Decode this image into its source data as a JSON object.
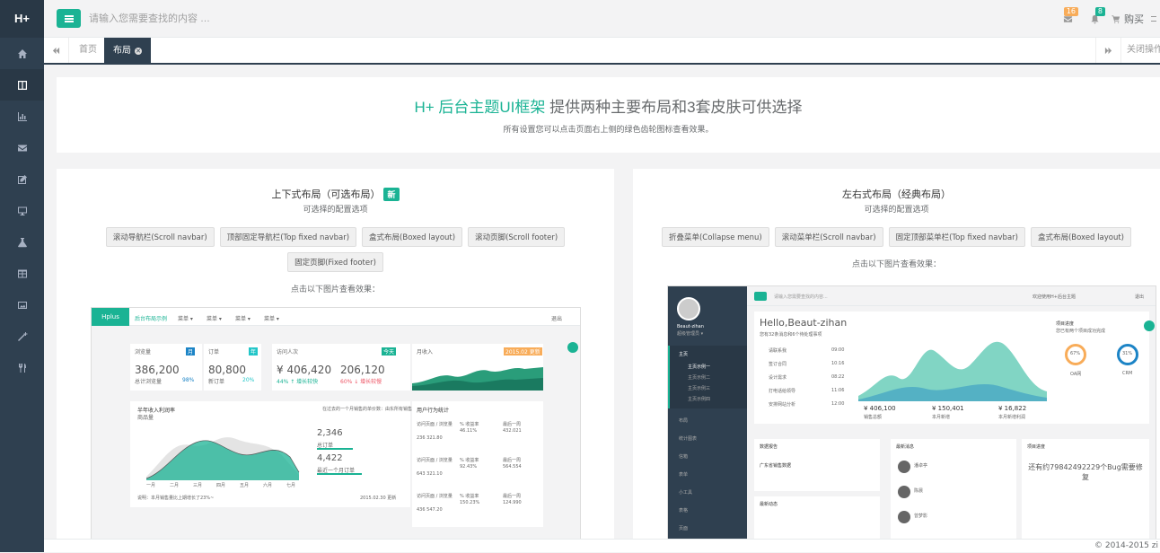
{
  "app": {
    "logo": "H+"
  },
  "sidebar": {
    "items": [
      {
        "icon": "home-icon"
      },
      {
        "icon": "columns-icon"
      },
      {
        "icon": "bar-chart-icon"
      },
      {
        "icon": "envelope-icon"
      },
      {
        "icon": "edit-icon"
      },
      {
        "icon": "desktop-icon"
      },
      {
        "icon": "flask-icon"
      },
      {
        "icon": "table-icon"
      },
      {
        "icon": "picture-icon"
      },
      {
        "icon": "magic-icon"
      },
      {
        "icon": "cutlery-icon"
      }
    ]
  },
  "header": {
    "search_placeholder": "请输入您需要查找的内容 …",
    "mail_count": "16",
    "bell_count": "8",
    "buy_label": "购买"
  },
  "tabs": {
    "home": "首页",
    "active": "布局",
    "close_ops": "关闭操作"
  },
  "hero": {
    "title_accent": "H+ 后台主题UI框架",
    "title_rest": " 提供两种主要布局和3套皮肤可供选择",
    "subtitle": "所有设置您可以点击页面右上侧的绿色齿轮图标查看效果。"
  },
  "left_card": {
    "title": "上下式布局（可选布局）",
    "badge": "新",
    "subtitle": "可选择的配置选项",
    "buttons": [
      "滚动导航栏(Scroll navbar)",
      "顶部固定导航栏(Top fixed navbar)",
      "盒式布局(Boxed layout)",
      "滚动页脚(Scroll footer)",
      "固定页脚(Fixed footer)"
    ],
    "hint": "点击以下图片查看效果："
  },
  "right_card": {
    "title": "左右式布局（经典布局）",
    "subtitle": "可选择的配置选项",
    "buttons": [
      "折叠菜单(Collapse menu)",
      "滚动菜单栏(Scroll navbar)",
      "固定顶部菜单栏(Top fixed navbar)",
      "盒式布局(Boxed layout)"
    ],
    "hint": "点击以下图片查看效果："
  },
  "preview_left": {
    "brand": "Hplus",
    "nav": [
      "后台布局示例",
      "菜单 ▾",
      "菜单 ▾",
      "菜单 ▾",
      "菜单 ▾"
    ],
    "logout": "退出",
    "stats": [
      {
        "label": "浏览量",
        "tag": "月",
        "value": "386,200",
        "sub": "总计浏览量",
        "pct": "98%"
      },
      {
        "label": "订单",
        "tag": "年",
        "value": "80,800",
        "sub": "新订单",
        "pct": "20%"
      },
      {
        "label": "访问人次",
        "tag": "今天",
        "value": "¥ 406,420",
        "value2": "206,120",
        "sub": "44% ↑ 增长较快",
        "sub2": "60% ↓ 增长较慢"
      },
      {
        "label": "月收入",
        "tag": "2015.02 更新"
      }
    ],
    "chart_title": "半年收入利润率",
    "chart_unit": "商品量",
    "chart_note": "在过去的一个月销售的单价数：由东所有销售：162,862",
    "months": [
      "一月",
      "二月",
      "三月",
      "四月",
      "五月",
      "六月",
      "七月"
    ],
    "kpi1": "2,346",
    "kpi1_label": "总订单",
    "kpi2": "4,422",
    "kpi2_label": "最近一个月订单",
    "foot_note": "说明：本月销售量比上期增长了23%~",
    "foot_date": "2015.02.30 更新",
    "side_title": "用户行为统计",
    "rows": [
      {
        "a": "访问页面 / 浏览量",
        "b": "236 321.80",
        "c": "% 收益率",
        "d": "46.11%",
        "e": "最后一周",
        "f": "432.021"
      },
      {
        "a": "访问页面 / 浏览量",
        "b": "643 321.10",
        "c": "% 收益率",
        "d": "92.43%",
        "e": "最后一周",
        "f": "564.554"
      },
      {
        "a": "访问页面 / 浏览量",
        "b": "436 547.20",
        "c": "% 收益率",
        "d": "150.23%",
        "e": "最后一周",
        "f": "124.990"
      }
    ]
  },
  "preview_right": {
    "user": "Beaut-zihan",
    "role": "超级管理员 ▾",
    "search": "请输入您需要查找的内容...",
    "welcome": "欢迎使用H+后台主题",
    "logout": "退出",
    "greeting": "Hello,Beaut-zihan",
    "greeting_sub": "您有32条消息和6个待处理事项",
    "tasks": [
      "请联系我",
      "签订合同",
      "设计需求",
      "打电话给领导",
      "安排网站分析"
    ],
    "task_times": [
      "09:00",
      "10:16",
      "08:22",
      "11:06",
      "12:00"
    ],
    "menu": [
      "主页",
      "主页示例一",
      "主页示例二",
      "主页示例三",
      "主页示例四",
      "布局",
      "统计图表",
      "信箱",
      "表单",
      "小工具",
      "表格",
      "页面"
    ],
    "progress_title": "项目进度",
    "progress_sub": "您已有两个项目成功完成",
    "pct1": "67%",
    "pct2": "31%",
    "pct1_label": "OA网",
    "pct2_label": "CRM",
    "stats": [
      "¥ 406,100",
      "¥ 150,401",
      "¥ 16,822"
    ],
    "stats_labels": [
      "销售总额",
      "本月新增",
      "本月新增利润"
    ],
    "box1": "数据报告",
    "box1_sub": "广东省销售数据",
    "box2": "最新消息",
    "box3": "项目进度",
    "bug_text": "还有约79842492229个Bug需要修复",
    "news_names": [
      "潘卓亭",
      "陈晨",
      "曾梦影"
    ],
    "activity": "最新动态"
  },
  "footer": {
    "copyright": "© 2014-2015 zi"
  },
  "colors": {
    "accent": "#1ab394",
    "sidebar": "#2f4050",
    "warning": "#f8ac59"
  }
}
